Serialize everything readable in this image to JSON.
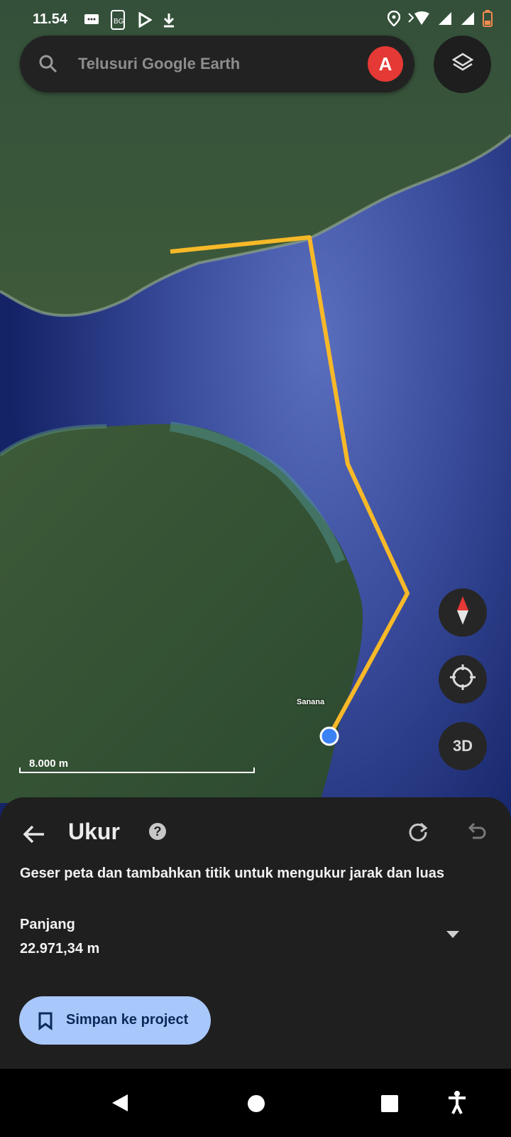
{
  "status_bar": {
    "time": "11.54",
    "left_icons": [
      "message-icon",
      "bbg-app-icon",
      "play-store-icon",
      "download-icon"
    ],
    "right_icons": [
      "location-icon",
      "wifi-icon",
      "signal-icon",
      "signal-icon-2",
      "battery-icon"
    ]
  },
  "search": {
    "placeholder": "Telusuri Google Earth",
    "avatar_initial": "A",
    "avatar_color": "#e53935"
  },
  "map": {
    "place_label": "Sanana",
    "scale_label": "8.000 m",
    "measure_line_color": "#f7b928",
    "controls": [
      "compass",
      "my-location",
      "3D"
    ],
    "three_d_label": "3D"
  },
  "sheet": {
    "title": "Ukur",
    "instruction": "Geser peta dan tambahkan titik untuk mengukur jarak dan luas",
    "length_label": "Panjang",
    "length_value": "22.971,34 m",
    "save_label": "Simpan ke project",
    "save_color": "#a8c7fa"
  }
}
